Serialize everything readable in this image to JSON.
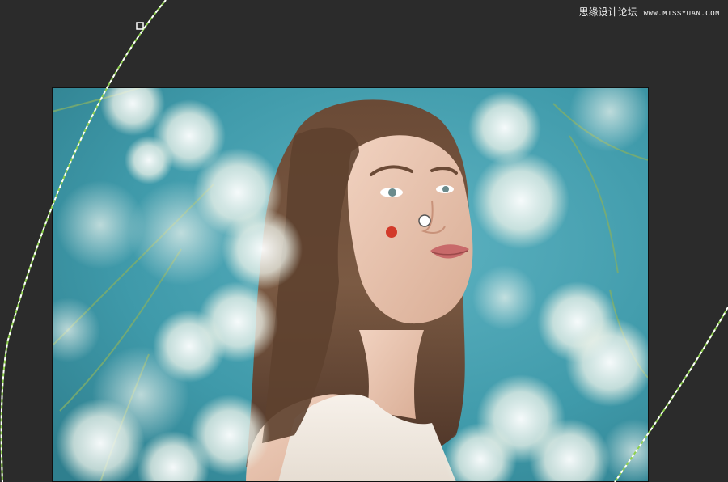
{
  "watermark": {
    "site_name": "思缘设计论坛",
    "url": "WWW.MISSYUAN.COM"
  },
  "tool": {
    "name": "radial-gradient-overlay",
    "pin_color": "#d23a2a",
    "center_handle_color": "#ffffff",
    "ellipse_colors": [
      "#8fd14f",
      "#ffffff"
    ]
  },
  "colors": {
    "canvas": "#2b2b2b",
    "photo_background": "#3f9aaa"
  }
}
